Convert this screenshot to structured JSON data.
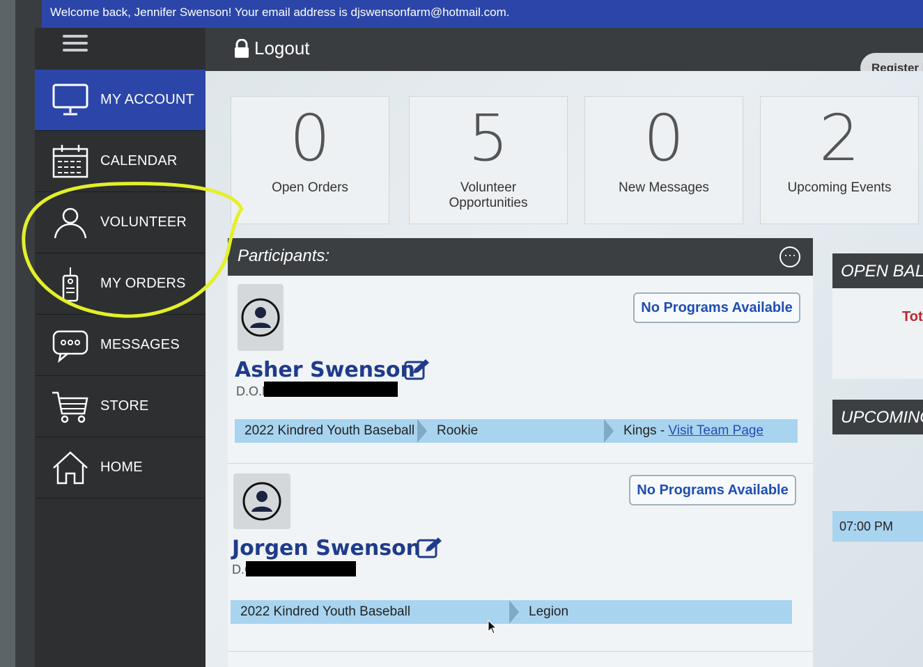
{
  "banner": {
    "text": "Welcome back, Jennifer Swenson! Your email address is djswensonfarm@hotmail.com."
  },
  "sidebar": {
    "items": [
      {
        "label": "MY ACCOUNT",
        "icon": "monitor-icon",
        "active": true
      },
      {
        "label": "CALENDAR",
        "icon": "calendar-icon",
        "active": false
      },
      {
        "label": "VOLUNTEER",
        "icon": "person-icon",
        "active": false
      },
      {
        "label": "MY ORDERS",
        "icon": "tag-icon",
        "active": false
      },
      {
        "label": "MESSAGES",
        "icon": "chat-icon",
        "active": false
      },
      {
        "label": "STORE",
        "icon": "cart-icon",
        "active": false
      },
      {
        "label": "HOME",
        "icon": "home-icon",
        "active": false
      }
    ]
  },
  "topbar": {
    "logout_label": "Logout",
    "register_label": "Register N"
  },
  "stats": [
    {
      "value": "0",
      "label": "Open Orders"
    },
    {
      "value": "5",
      "label": "Volunteer Opportunities"
    },
    {
      "value": "0",
      "label": "New Messages"
    },
    {
      "value": "2",
      "label": "Upcoming Events"
    }
  ],
  "participants": {
    "title": "Participants:",
    "list": [
      {
        "name": "Asher Swenson",
        "dob_label": "D.O.B.",
        "no_programs": "No Programs Available",
        "program": "2022 Kindred Youth Baseball",
        "division": "Rookie",
        "team": "Kings -",
        "team_link": "Visit Team Page"
      },
      {
        "name": "Jorgen Swenson",
        "dob_label": "D.O",
        "no_programs": "No Programs Available",
        "program": "2022 Kindred Youth Baseball",
        "division": "Legion",
        "team": "",
        "team_link": ""
      }
    ]
  },
  "open_balance": {
    "title": "OPEN BALA",
    "total_label": "Tota"
  },
  "upcoming": {
    "title": "UPCOMING",
    "event_time": "07:00 PM"
  },
  "colors": {
    "accent": "#2b46a8",
    "sidebar": "#2d2f31",
    "program_bar": "#a8d4ef",
    "link": "#1f4db3",
    "highlight": "#e4ef2a"
  }
}
